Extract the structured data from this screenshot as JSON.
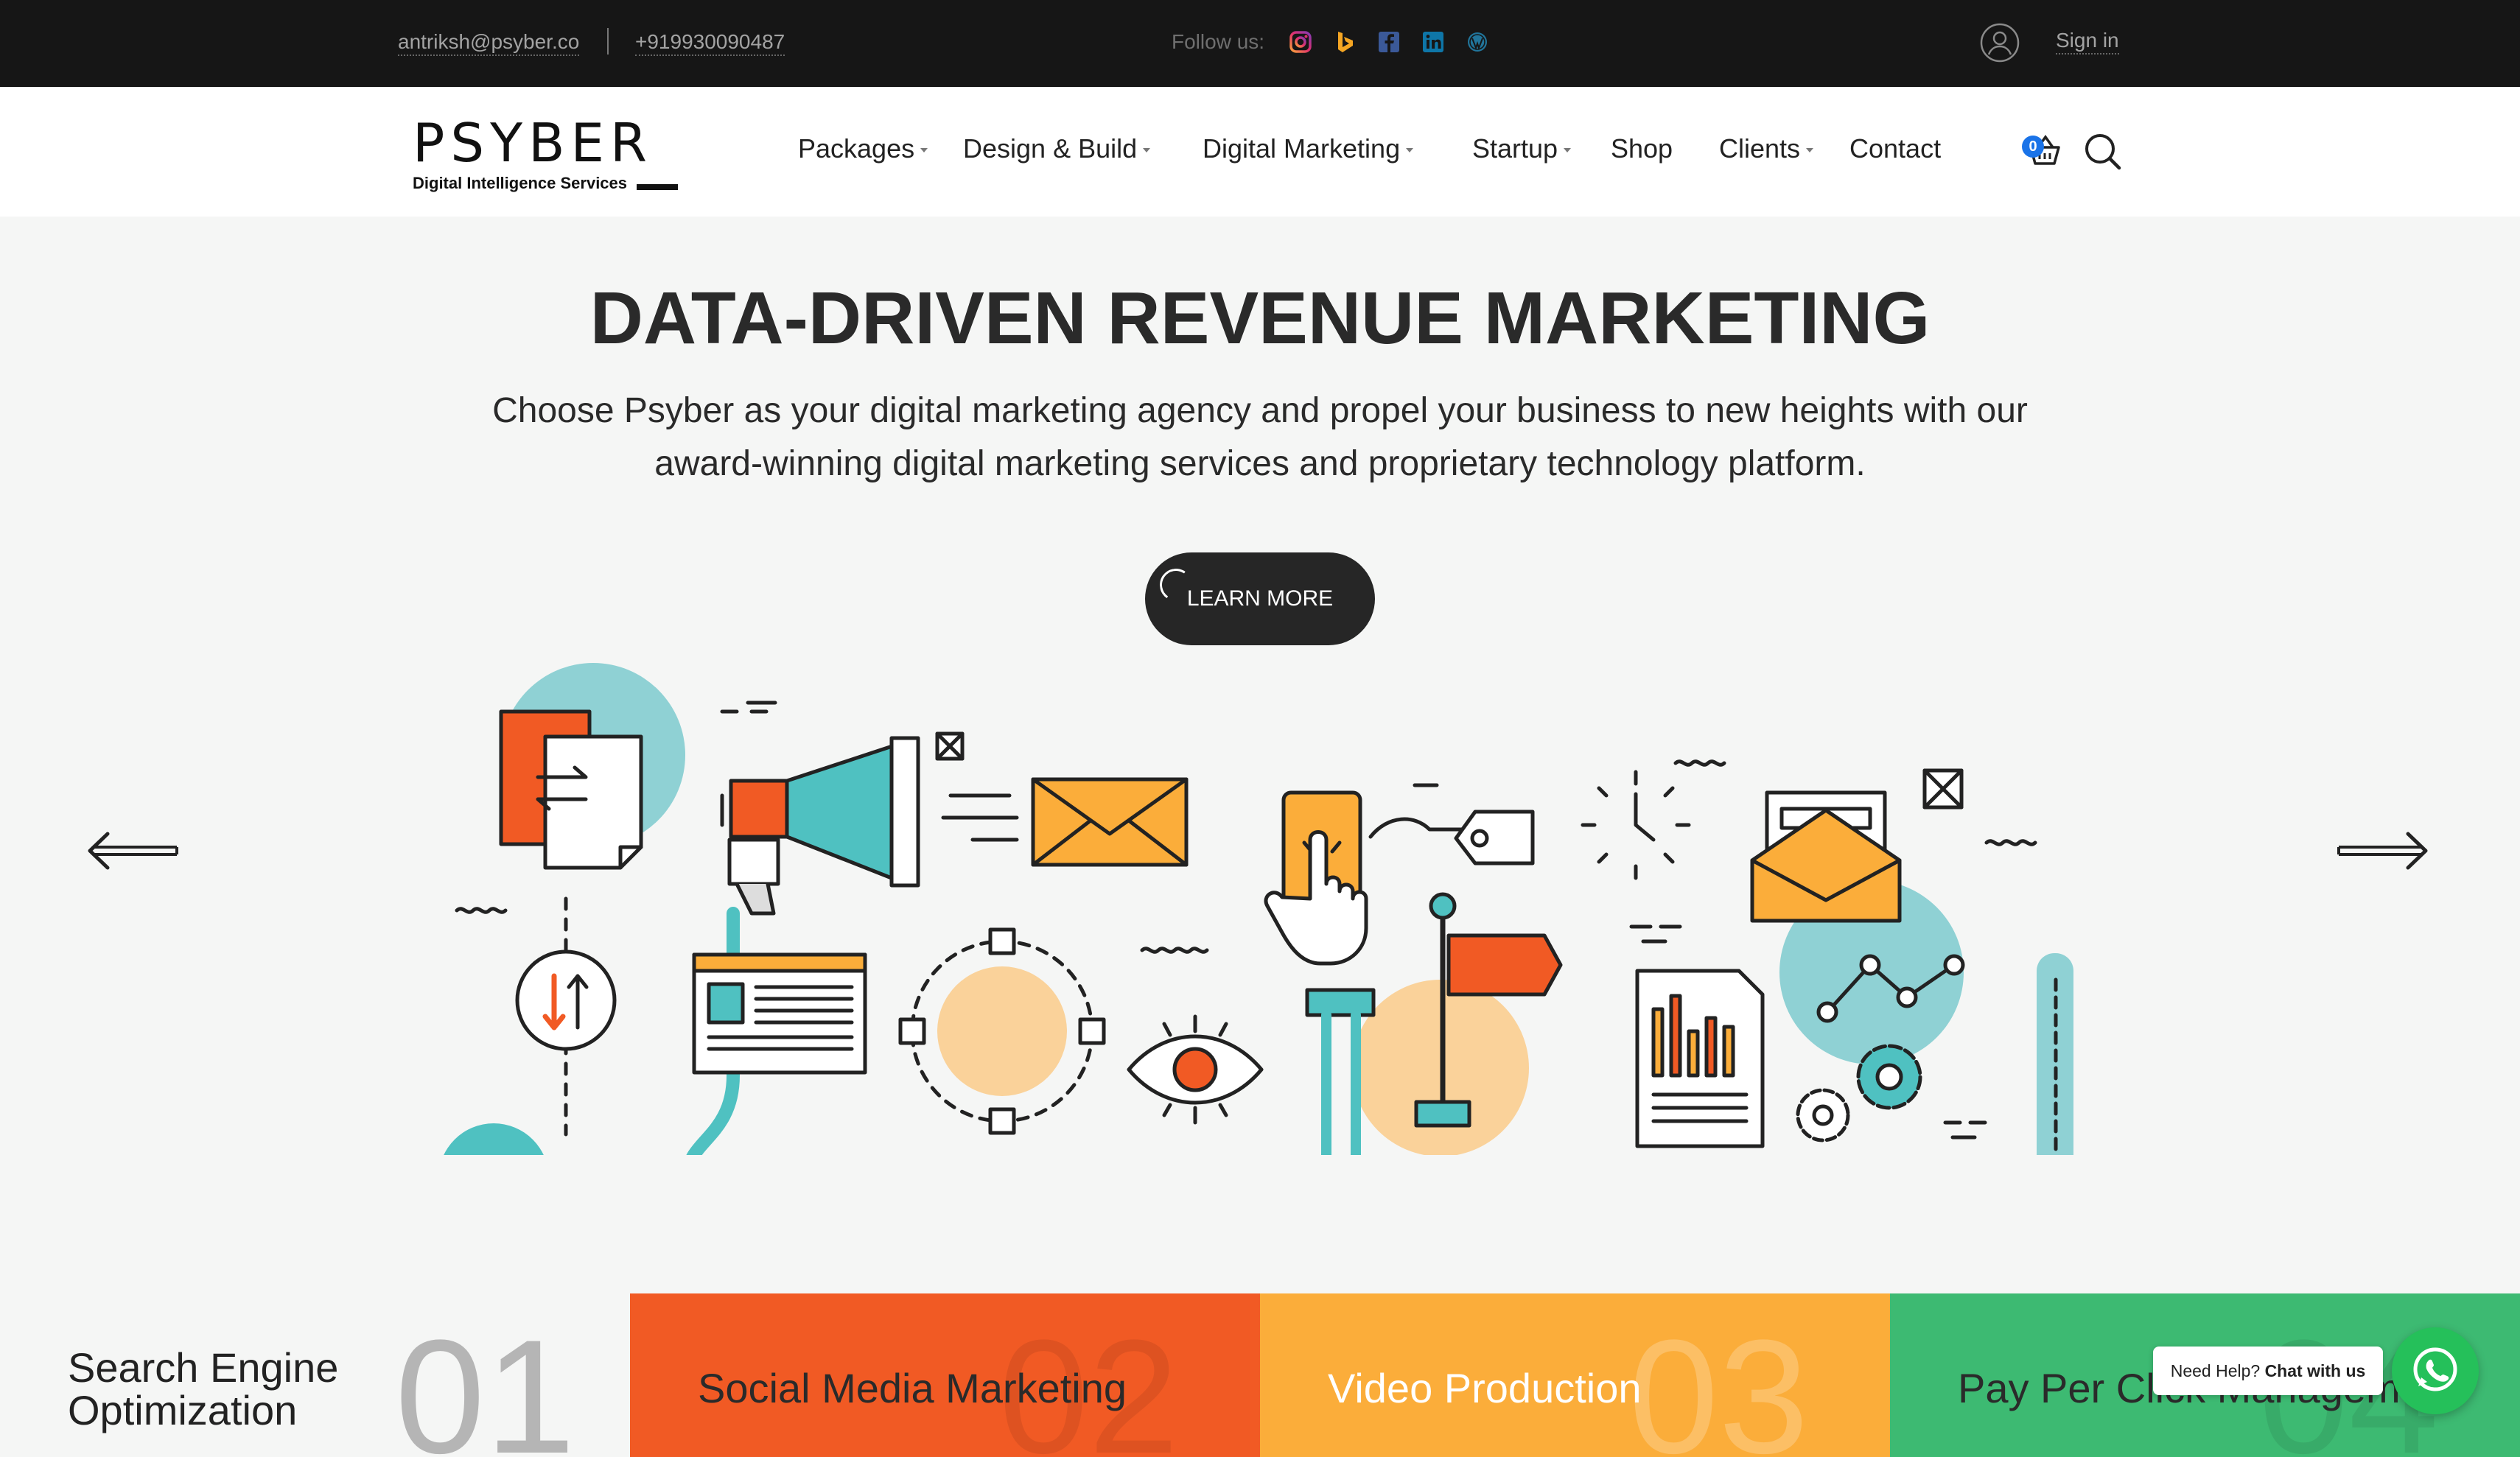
{
  "topbar": {
    "email": "antriksh@psyber.co",
    "phone": "+919930090487",
    "follow_label": "Follow us:",
    "social_icons": [
      "instagram-icon",
      "bing-icon",
      "facebook-icon",
      "linkedin-icon",
      "wordpress-icon"
    ],
    "signin_label": "Sign in"
  },
  "brand": {
    "logo_text": "PSYBER",
    "tagline": "Digital Intelligence Services"
  },
  "nav": {
    "items": [
      {
        "label": "Packages",
        "dropdown": true
      },
      {
        "label": "Design & Build",
        "dropdown": true
      },
      {
        "label": "Digital Marketing",
        "dropdown": true
      },
      {
        "label": "Startup",
        "dropdown": true
      },
      {
        "label": "Shop",
        "dropdown": false
      },
      {
        "label": "Clients",
        "dropdown": true
      },
      {
        "label": "Contact",
        "dropdown": false
      }
    ],
    "cart_count": "0"
  },
  "hero": {
    "title": "DATA-DRIVEN REVENUE MARKETING",
    "subtitle_line1": "Choose Psyber as your digital marketing agency and propel your business to new heights with our",
    "subtitle_line2": "award-winning digital marketing services and proprietary technology platform.",
    "cta_label": "LEARN MORE"
  },
  "services": [
    {
      "label_line1": "Search Engine",
      "label_line2": "Optimization",
      "number": "01",
      "color": "#f5f6f5"
    },
    {
      "label_line1": "Social Media Marketing",
      "number": "02",
      "color": "#f15a24"
    },
    {
      "label_line1": "Video Production",
      "number": "03",
      "color": "#fbad3a"
    },
    {
      "label_line1": "Pay Per Click Manageme",
      "number": "04",
      "color": "#3dba72"
    }
  ],
  "chat": {
    "prefix": "Need Help?",
    "cta": "Chat with us"
  },
  "colors": {
    "orange": "#f15a24",
    "amber": "#fbad3a",
    "green": "#3dba72",
    "teal": "#4fc1c1",
    "dark": "#161616"
  }
}
